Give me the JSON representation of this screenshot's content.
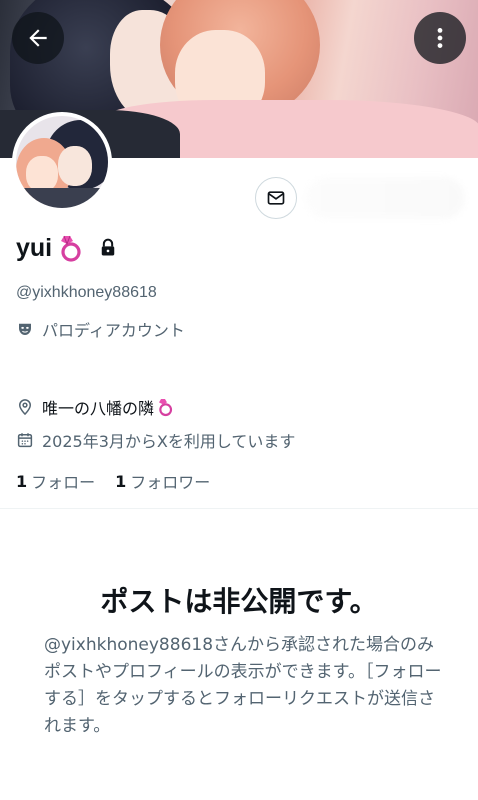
{
  "header": {
    "back_icon": "arrow-left-icon",
    "more_icon": "more-vertical-icon"
  },
  "profile": {
    "display_name": "yui",
    "name_emoji": "💍",
    "protected_icon": "lock-icon",
    "handle": "@yixhkhoney88618",
    "parody_label": "パロディアカウント",
    "location": "唯一の八幡の隣",
    "location_emoji": "💍",
    "joined": "2025年3月からXを利用しています",
    "following_count": "1",
    "following_label": "フォロー",
    "followers_count": "1",
    "followers_label": "フォロワー"
  },
  "private_notice": {
    "title": "ポストは非公開です。",
    "body": "@yixhkhoney88618さんから承認された場合のみポストやプロフィールの表示ができます。［フォローする］をタップするとフォローリクエストが送信されます。"
  },
  "colors": {
    "text_primary": "#0f1419",
    "text_secondary": "#536471",
    "border": "#cfd9de",
    "emoji_accent": "#e0409a"
  }
}
